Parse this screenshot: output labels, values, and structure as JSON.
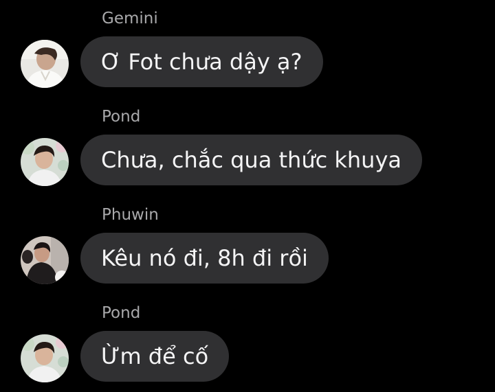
{
  "messages": [
    {
      "sender": "Gemini",
      "text": "Ơ Fot chưa dậy ạ?"
    },
    {
      "sender": "Pond",
      "text": "Chưa, chắc qua thức khuya"
    },
    {
      "sender": "Phuwin",
      "text": "Kêu nó đi, 8h đi rồi"
    },
    {
      "sender": "Pond",
      "text": "Ừm để cố"
    }
  ],
  "colors": {
    "background": "#000000",
    "bubble": "#303032",
    "message_text": "#f4f4f5",
    "sender_name": "#a9a9ab"
  },
  "icons": [
    "avatar-gemini",
    "avatar-pond",
    "avatar-phuwin"
  ]
}
